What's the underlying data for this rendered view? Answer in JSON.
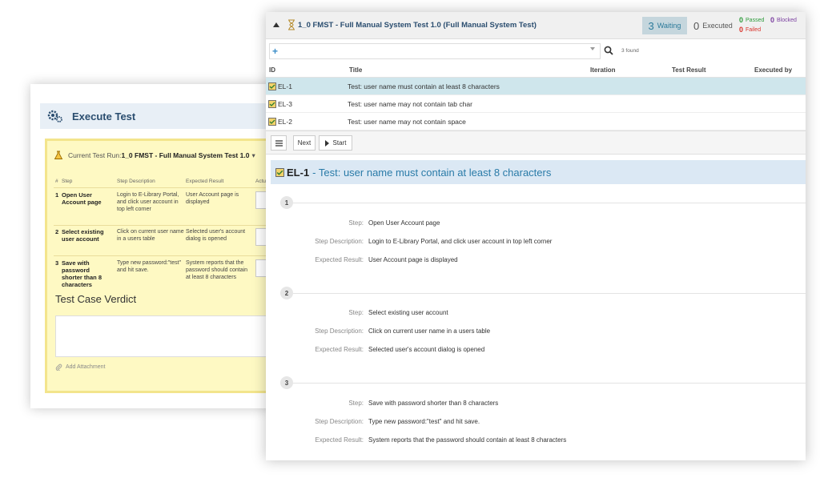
{
  "execute": {
    "title": "Execute Test",
    "run_label": "Current Test Run:",
    "run_name": "1_0 FMST - Full Manual System Test 1.0",
    "run_caret": "▾",
    "columns": [
      "#",
      "Step",
      "Step Description",
      "Expected Result",
      "Actu"
    ],
    "steps": [
      {
        "num": "1",
        "step": "Open User Account page",
        "description": "Login to E-Library Portal, and click user account in top left corner",
        "expected": "User Account page is displayed"
      },
      {
        "num": "2",
        "step": "Select existing user account",
        "description": "Click on current user name in a users table",
        "expected": "Selected user's account dialog is opened"
      },
      {
        "num": "3",
        "step": "Save with password shorter than 8 characters",
        "description": "Type new password:\"test\" and hit save.",
        "expected": "System reports that the password should contain at least 8 characters"
      }
    ],
    "verdict_title": "Test Case Verdict",
    "attachment_label": "Add Attachment"
  },
  "run": {
    "title": "1_0 FMST - Full Manual System Test 1.0 (Full Manual System Test)",
    "waiting_count": "3",
    "waiting_label": "Waiting",
    "executed_count": "0",
    "executed_label": "Executed",
    "passed_count": "0",
    "passed_label": "Passed",
    "failed_count": "0",
    "failed_label": "Failed",
    "blocked_count": "0",
    "blocked_label": "Blocked",
    "found_label": "3 found",
    "plus": "+",
    "columns": [
      "ID",
      "Title",
      "Iteration",
      "Test Result",
      "Executed by"
    ],
    "rows": [
      {
        "id": "EL-1",
        "title": "Test: user name must contain at least 8 characters"
      },
      {
        "id": "EL-3",
        "title": "Test: user name may not contain tab char"
      },
      {
        "id": "EL-2",
        "title": "Test: user name may not contain space"
      }
    ],
    "next_label": "Next",
    "start_label": "Start"
  },
  "detail": {
    "id": "EL-1",
    "title": "- Test: user name must contain at least 8 characters",
    "step_label": "Step:",
    "description_label": "Step Description:",
    "expected_label": "Expected Result:",
    "steps": [
      {
        "num": "1",
        "step": "Open User Account page",
        "description": "Login to E-Library Portal, and click user account in top left corner",
        "expected": "User Account page is displayed"
      },
      {
        "num": "2",
        "step": "Select existing user account",
        "description": "Click on current user name in a users table",
        "expected": "Selected user's account dialog is opened"
      },
      {
        "num": "3",
        "step": "Save with password shorter than 8 characters",
        "description": "Type new password:\"test\" and hit save.",
        "expected": "System reports that the password should contain at least 8 characters"
      }
    ]
  },
  "colors": {
    "accent": "#2a7ba8",
    "highlight": "#cfe6ec",
    "panel_yellow": "#fef9c3",
    "passed": "#2e9b3c",
    "failed": "#d9332b",
    "blocked": "#7b3fa0"
  }
}
